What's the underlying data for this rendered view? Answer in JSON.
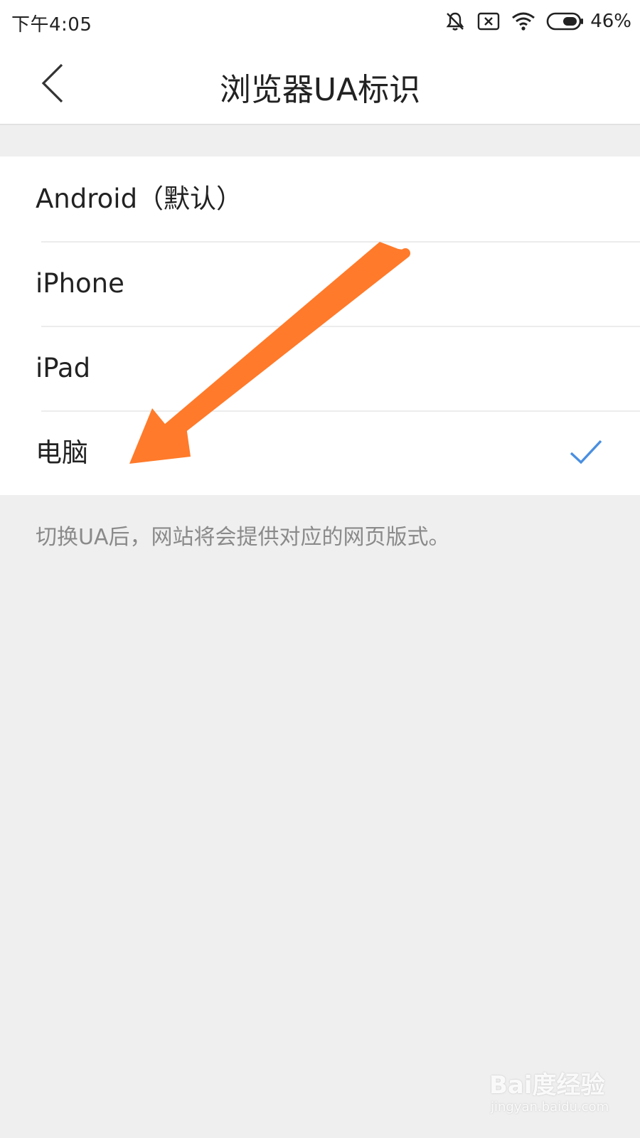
{
  "status_bar": {
    "time": "下午4:05",
    "battery_percent": "46%",
    "icons": [
      "mute-bell-icon",
      "no-sim-icon",
      "wifi-icon",
      "battery-icon"
    ]
  },
  "header": {
    "title": "浏览器UA标识",
    "back_icon": "chevron-left-icon"
  },
  "ua_options": [
    {
      "label": "Android（默认）",
      "selected": false
    },
    {
      "label": "iPhone",
      "selected": false
    },
    {
      "label": "iPad",
      "selected": false
    },
    {
      "label": "电脑",
      "selected": true
    }
  ],
  "hint": "切换UA后，网站将会提供对应的网页版式。",
  "watermark": {
    "logo": "Bai度经验",
    "url": "jingyan.baidu.com"
  },
  "colors": {
    "check": "#4a8fe0",
    "annotation_arrow": "#ff7a2a",
    "background": "#efefef"
  }
}
